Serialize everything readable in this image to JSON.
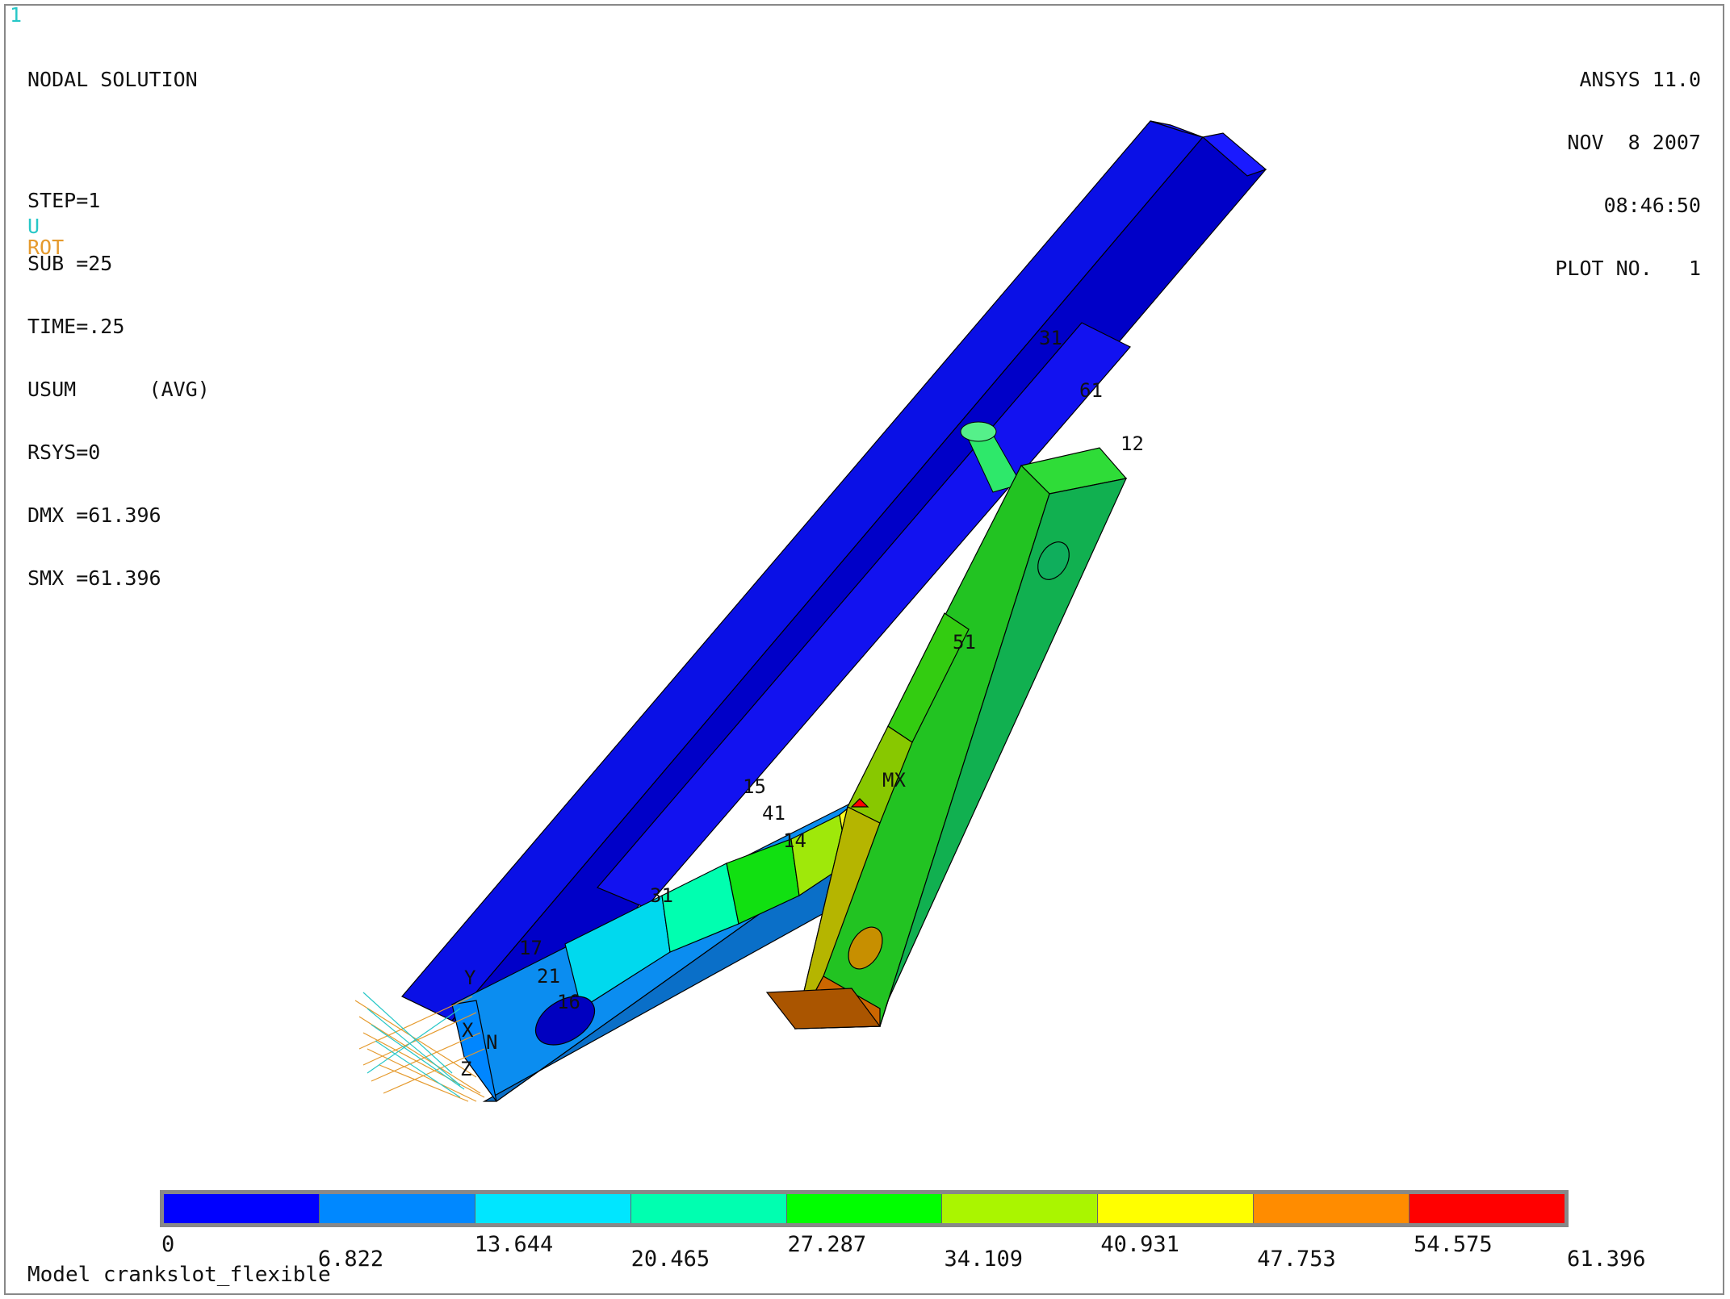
{
  "window_number": "1",
  "info": {
    "title": "NODAL SOLUTION",
    "step": "STEP=1",
    "sub": "SUB =25",
    "time": "TIME=.25",
    "usum": "USUM      (AVG)",
    "rsys": "RSYS=0",
    "dmx": "DMX =61.396",
    "smx": "SMX =61.396"
  },
  "legend_symbols": {
    "u": "U",
    "rot": "ROT",
    "u_color": "#27c7c7",
    "rot_color": "#e59a2d"
  },
  "header": {
    "product": "ANSYS 11.0",
    "date": "NOV  8 2007",
    "time": "08:46:50",
    "plot_no": "PLOT NO.   1"
  },
  "contour": {
    "colors": [
      "#0000ff",
      "#0088ff",
      "#00e6ff",
      "#00ffb0",
      "#00ff00",
      "#aaf500",
      "#ffff00",
      "#ff8c00",
      "#ff0000"
    ],
    "ticks": [
      "0",
      "6.822",
      "13.644",
      "20.465",
      "27.287",
      "34.109",
      "40.931",
      "47.753",
      "54.575",
      "61.396"
    ]
  },
  "annotations": {
    "node_labels": [
      "31",
      "61",
      "12",
      "51",
      "MX",
      "15",
      "41",
      "14",
      "31",
      "17",
      "21",
      "16",
      "Y",
      "X",
      "Z",
      "N"
    ]
  },
  "model": "Model crankslot_flexible"
}
